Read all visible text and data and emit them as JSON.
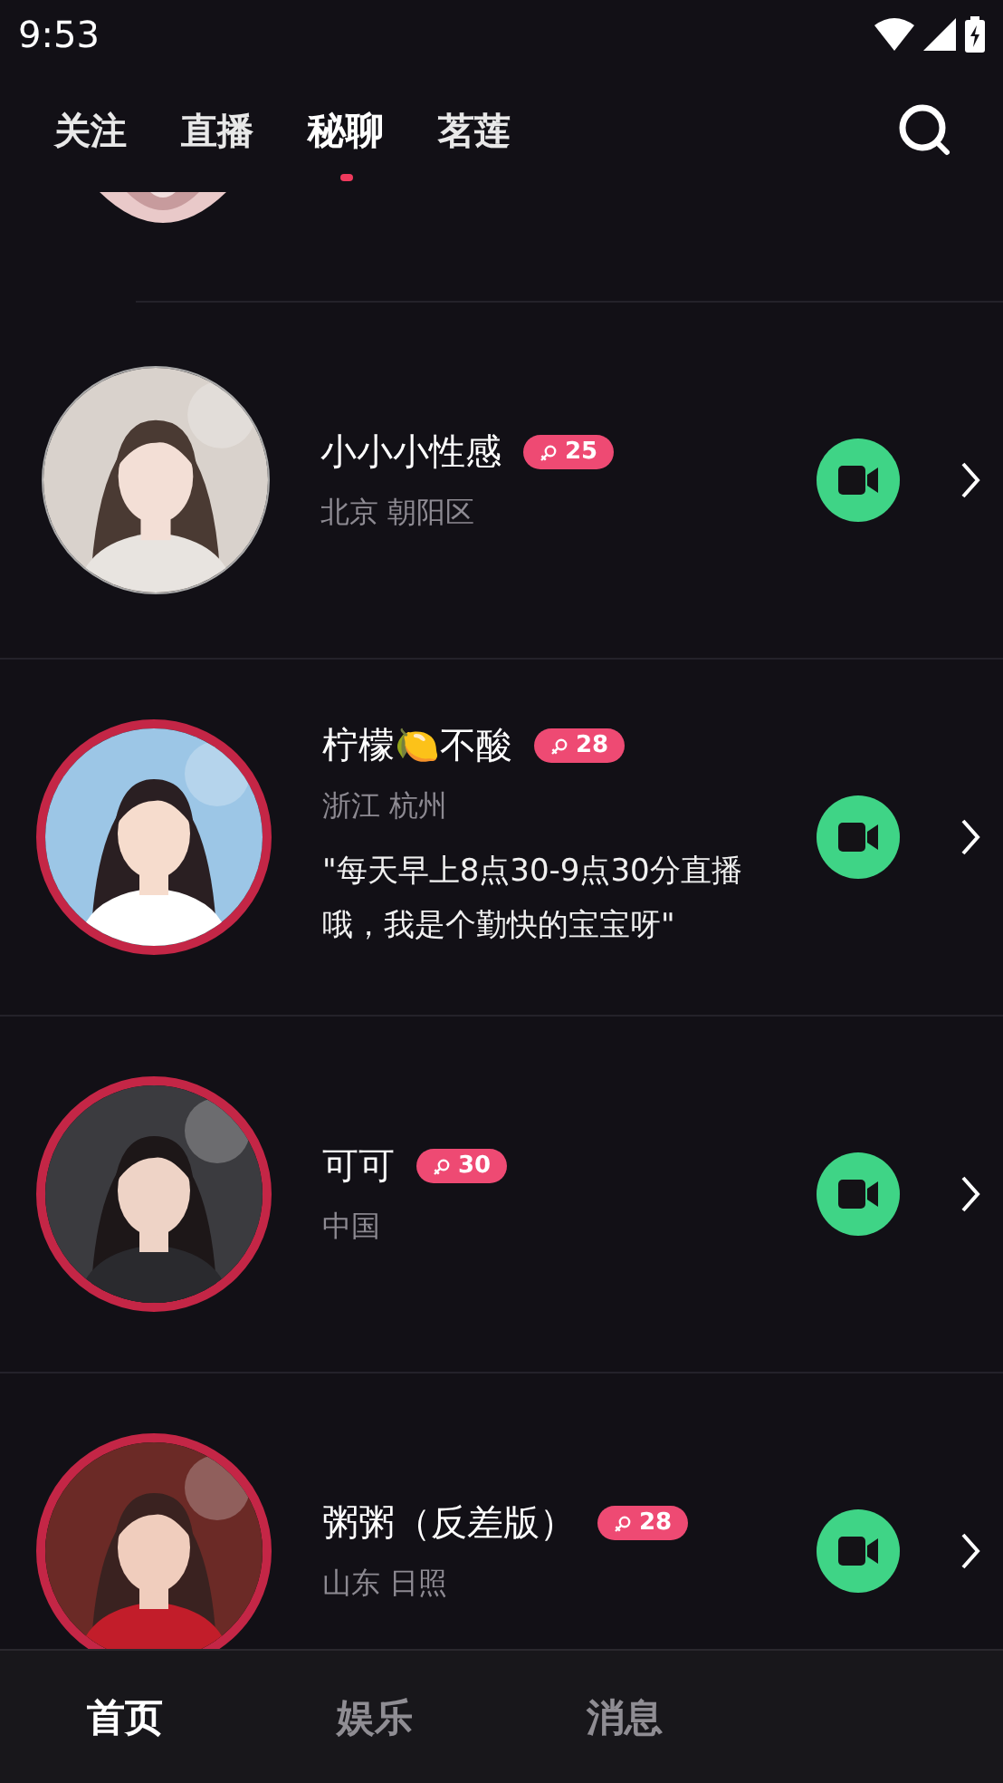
{
  "status_bar": {
    "time": "9:53"
  },
  "tabs": [
    {
      "label": "关注",
      "selected": false
    },
    {
      "label": "直播",
      "selected": false
    },
    {
      "label": "秘聊",
      "selected": true
    },
    {
      "label": "茗莲",
      "selected": false
    }
  ],
  "users": [
    {
      "name": "小小小性感",
      "age": "25",
      "location": "北京 朝阳区",
      "ring": false
    },
    {
      "name": "柠檬🍋不酸",
      "age": "28",
      "location": "浙江 杭州",
      "bio": "\"每天早上8点30-9点30分直播哦，我是个勤快的宝宝呀\"",
      "ring": true
    },
    {
      "name": "可可",
      "age": "30",
      "location": "中国",
      "ring": true
    },
    {
      "name": "粥粥（反差版）",
      "age": "28",
      "location": "山东 日照",
      "ring": true
    }
  ],
  "bottom_nav": [
    {
      "label": "首页",
      "selected": true
    },
    {
      "label": "娱乐",
      "selected": false
    },
    {
      "label": "消息",
      "selected": false
    }
  ]
}
